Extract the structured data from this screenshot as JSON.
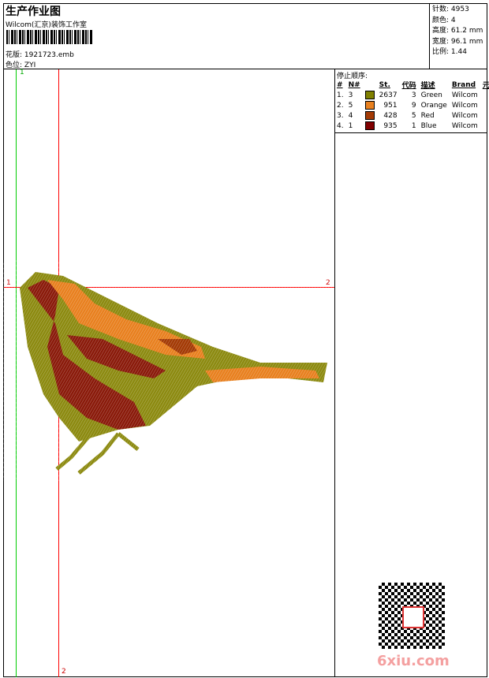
{
  "header": {
    "title": "生产作业图",
    "company": "Wilcom(汇京)装饰工作室",
    "design_label": "花版:",
    "design_file": "1921723.emb",
    "colorway_label": "色位:",
    "colorway": "ZYI"
  },
  "stats": [
    {
      "label": "针数:",
      "value": "4953"
    },
    {
      "label": "颜色:",
      "value": "4"
    },
    {
      "label": "高度:",
      "value": "61.2 mm"
    },
    {
      "label": "宽度:",
      "value": "96.1 mm"
    },
    {
      "label": "比例:",
      "value": "1.44"
    }
  ],
  "stop_sequence": {
    "title": "停止顺序:",
    "headers": [
      "#",
      "N#",
      "St.",
      "代码",
      "描述",
      "Brand",
      "元素"
    ],
    "rows": [
      {
        "idx": "1.",
        "n": "3",
        "color": "#808000",
        "st": "2637",
        "code": "3",
        "desc": "Green",
        "brand": "Wilcom"
      },
      {
        "idx": "2.",
        "n": "5",
        "color": "#e8801f",
        "st": "951",
        "code": "9",
        "desc": "Orange",
        "brand": "Wilcom"
      },
      {
        "idx": "3.",
        "n": "4",
        "color": "#a33a05",
        "st": "428",
        "code": "5",
        "desc": "Red",
        "brand": "Wilcom"
      },
      {
        "idx": "4.",
        "n": "1",
        "color": "#800000",
        "st": "935",
        "code": "1",
        "desc": "Blue",
        "brand": "Wilcom"
      }
    ]
  },
  "guides": {
    "green_top": "1",
    "red_bottom": "2",
    "red_left": "1",
    "red_right": "2"
  },
  "watermark": "6xiu.com"
}
